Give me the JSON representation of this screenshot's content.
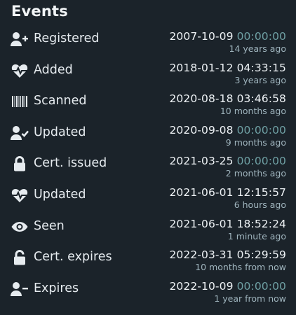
{
  "header": {
    "title": "Events"
  },
  "events": [
    {
      "icon": "user-plus-icon",
      "label": "Registered",
      "date": "2007-10-09",
      "time": "00:00:00",
      "time_is_zero": true,
      "relative": "14 years ago"
    },
    {
      "icon": "heartbeat-icon",
      "label": "Added",
      "date": "2018-01-12",
      "time": "04:33:15",
      "time_is_zero": false,
      "relative": "3 years ago"
    },
    {
      "icon": "barcode-icon",
      "label": "Scanned",
      "date": "2020-08-18",
      "time": "03:46:58",
      "time_is_zero": false,
      "relative": "10 months ago"
    },
    {
      "icon": "user-check-icon",
      "label": "Updated",
      "date": "2020-09-08",
      "time": "00:00:00",
      "time_is_zero": true,
      "relative": "9 months ago"
    },
    {
      "icon": "lock-icon",
      "label": "Cert. issued",
      "date": "2021-03-25",
      "time": "00:00:00",
      "time_is_zero": true,
      "relative": "2 months ago"
    },
    {
      "icon": "heartbeat-icon",
      "label": "Updated",
      "date": "2021-06-01",
      "time": "12:15:57",
      "time_is_zero": false,
      "relative": "6 hours ago"
    },
    {
      "icon": "eye-icon",
      "label": "Seen",
      "date": "2021-06-01",
      "time": "18:52:24",
      "time_is_zero": false,
      "relative": "1 minute ago"
    },
    {
      "icon": "unlock-icon",
      "label": "Cert. expires",
      "date": "2022-03-31",
      "time": "05:29:59",
      "time_is_zero": false,
      "relative": "10 months from now"
    },
    {
      "icon": "user-minus-icon",
      "label": "Expires",
      "date": "2022-10-09",
      "time": "00:00:00",
      "time_is_zero": true,
      "relative": "1 year from now"
    }
  ],
  "colors": {
    "background": "#1b232a",
    "text": "#e6ebef",
    "zero_time": "#6fa0a4",
    "relative": "#9fb4bd"
  }
}
